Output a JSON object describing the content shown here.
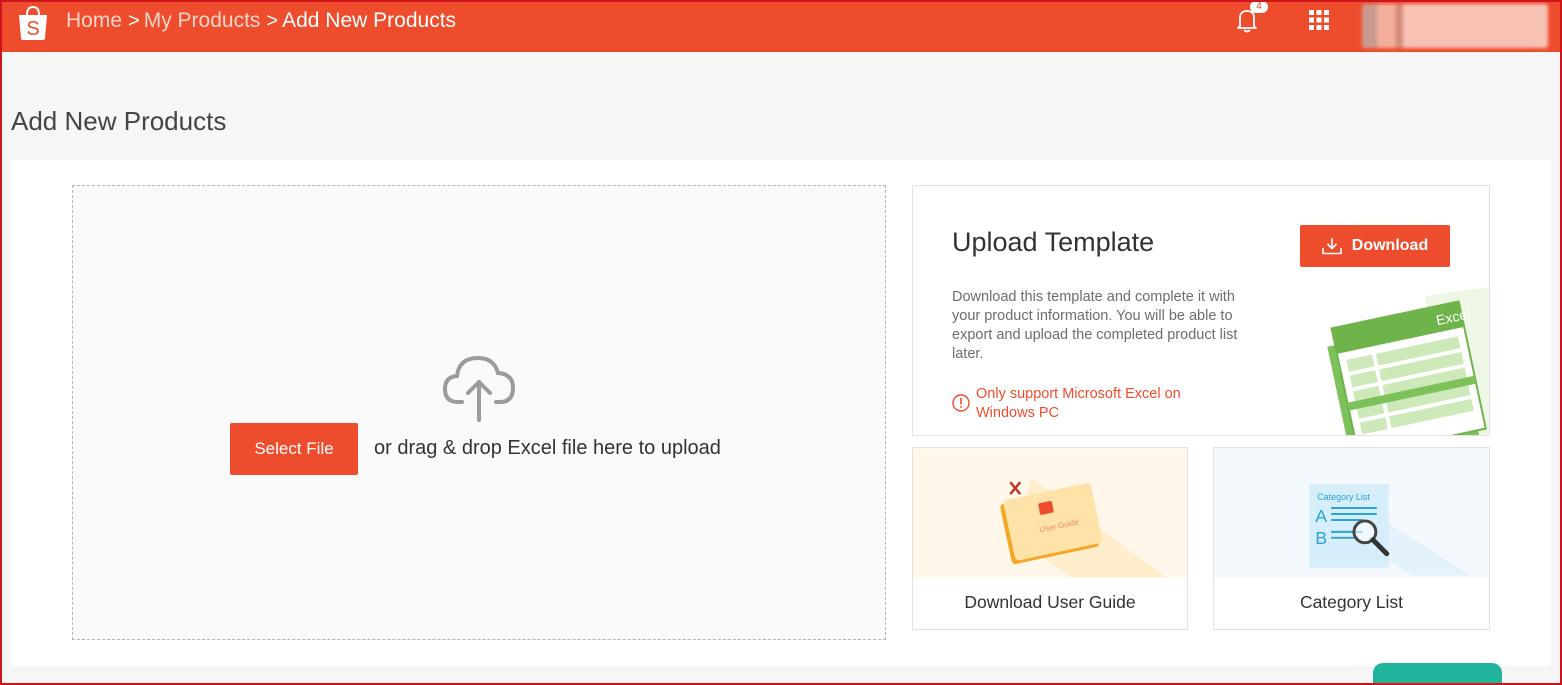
{
  "header": {
    "breadcrumbs": [
      "Home",
      "My Products",
      "Add New Products"
    ],
    "separator": ">",
    "notification_count": "4",
    "icons": {
      "logo": "shopee-bag-icon",
      "bell": "bell-icon",
      "apps": "grid-icon",
      "avatar": "avatar"
    },
    "brand_color": "#ee4d2d"
  },
  "page": {
    "title": "Add New Products"
  },
  "upload": {
    "select_file_label": "Select File",
    "drop_text": "or drag & drop Excel file here to upload",
    "icon": "cloud-upload-icon"
  },
  "template": {
    "title": "Upload Template",
    "download_label": "Download",
    "description": "Download this template and complete it with your product information. You will be able to export and upload the completed product list later.",
    "warning": "Only support Microsoft Excel on Windows PC",
    "excel_label": "Excel"
  },
  "cards": {
    "user_guide": {
      "label": "Download User Guide",
      "art_text": "User Guide"
    },
    "category": {
      "label": "Category List",
      "art_title": "Category List",
      "letters": [
        "A",
        "B"
      ]
    }
  }
}
